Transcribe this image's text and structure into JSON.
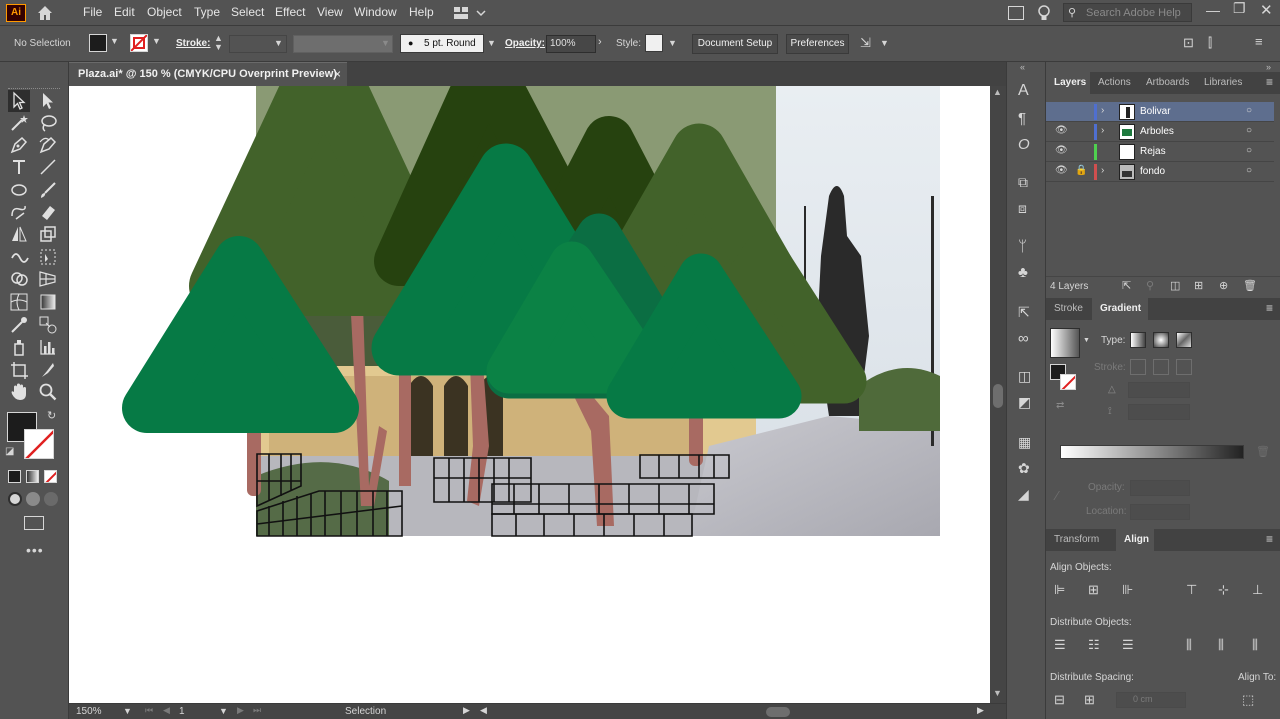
{
  "app": {
    "logo": "Ai",
    "home_icon": "home-icon"
  },
  "menu": [
    "File",
    "Edit",
    "Object",
    "Type",
    "Select",
    "Effect",
    "View",
    "Window",
    "Help"
  ],
  "search": {
    "placeholder": "Search Adobe Help"
  },
  "control": {
    "selection_label": "No Selection",
    "stroke_label": "Stroke:",
    "brush_value": "5 pt. Round",
    "opacity_label": "Opacity:",
    "opacity_value": "100%",
    "style_label": "Style:",
    "document_setup": "Document Setup",
    "preferences": "Preferences"
  },
  "document": {
    "tab_title": "Plaza.ai* @ 150 % (CMYK/CPU Overprint Preview)",
    "close": "×"
  },
  "status": {
    "zoom": "150%",
    "artboard": "1",
    "mode": "Selection"
  },
  "panels": {
    "top_tabs": [
      "Layers",
      "Actions",
      "Artboards",
      "Libraries"
    ],
    "layers": [
      {
        "name": "Bolivar",
        "visible": false,
        "locked": false,
        "color": "#4f6fd0",
        "selected": true
      },
      {
        "name": "Arboles",
        "visible": true,
        "locked": false,
        "color": "#4f6fd0",
        "selected": false
      },
      {
        "name": "Rejas",
        "visible": true,
        "locked": false,
        "color": "#4fd04f",
        "selected": false
      },
      {
        "name": "fondo",
        "visible": true,
        "locked": true,
        "color": "#d04f4f",
        "selected": false
      }
    ],
    "layer_count": "4 Layers",
    "mid_tabs": [
      "Stroke",
      "Gradient"
    ],
    "gradient": {
      "type_label": "Type:",
      "stroke_label": "Stroke:",
      "opacity_label": "Opacity:",
      "location_label": "Location:"
    },
    "bottom_tabs": [
      "Transform",
      "Align"
    ],
    "align": {
      "align_objects": "Align Objects:",
      "distribute_objects": "Distribute Objects:",
      "distribute_spacing": "Distribute Spacing:",
      "align_to": "Align To:",
      "spacing_value": "0 cm"
    }
  },
  "colors": {
    "tree_dark": "#26420f",
    "tree_olive": "#42622a",
    "tree_green": "#067a45",
    "tree_mid": "#0b8245",
    "trunk": "#a86a62"
  }
}
